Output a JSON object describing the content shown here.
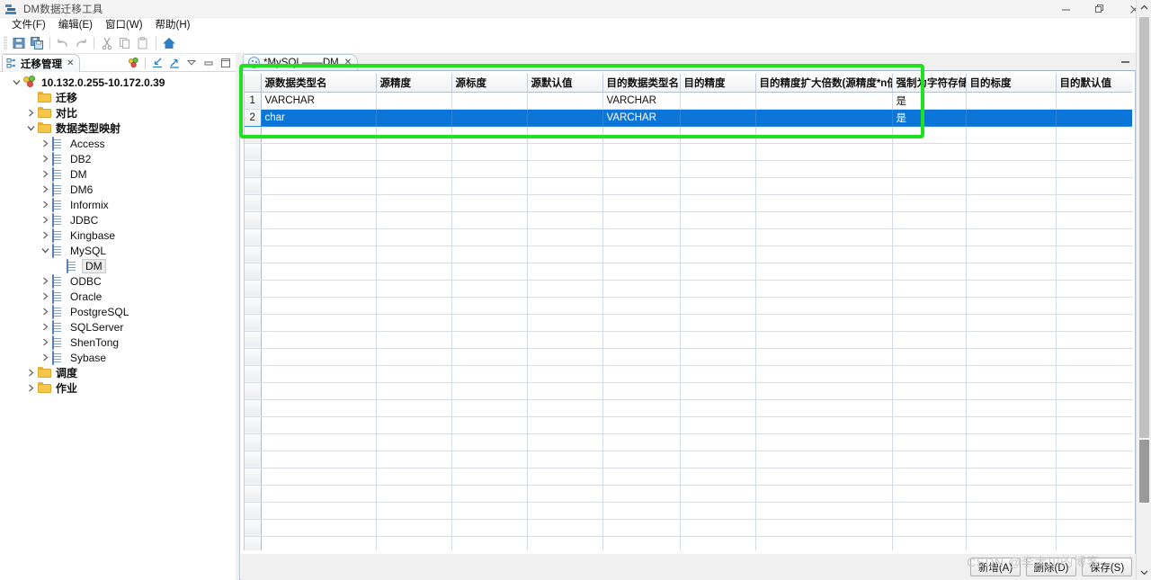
{
  "window": {
    "title": "DM数据迁移工具",
    "app_icon": "database-stack-icon",
    "controls": {
      "minimize": "minimize-icon",
      "restore": "restore-icon",
      "close": "close-icon"
    }
  },
  "menubar": {
    "items": [
      {
        "label": "文件(F)"
      },
      {
        "label": "编辑(E)"
      },
      {
        "label": "窗口(W)"
      },
      {
        "label": "帮助(H)"
      }
    ]
  },
  "toolbar": {
    "buttons": [
      {
        "name": "save-icon",
        "glyph": "floppy"
      },
      {
        "name": "save-all-icon",
        "glyph": "floppy-multi"
      },
      {
        "name": "undo-icon",
        "glyph": "undo"
      },
      {
        "name": "redo-icon",
        "glyph": "redo"
      },
      {
        "name": "cut-icon",
        "glyph": "scissors"
      },
      {
        "name": "copy-icon",
        "glyph": "copy"
      },
      {
        "name": "paste-icon",
        "glyph": "clipboard"
      },
      {
        "name": "home-icon",
        "glyph": "home"
      }
    ]
  },
  "sidebar": {
    "view_tab": {
      "label": "迁移管理",
      "icon": "migration-manage-icon",
      "close": "✕"
    },
    "view_tools": [
      {
        "name": "new-connection-icon"
      },
      {
        "name": "import-icon"
      },
      {
        "name": "export-icon"
      },
      {
        "name": "view-menu-icon"
      },
      {
        "name": "minimize-view-icon"
      },
      {
        "name": "maximize-view-icon"
      }
    ],
    "tree": [
      {
        "label": "10.132.0.255-10.172.0.39",
        "indent": 0,
        "twist": "expanded",
        "icon": "connection-icon",
        "bold": true,
        "selected": false
      },
      {
        "label": "迁移",
        "indent": 1,
        "twist": "none",
        "icon": "folder-icon",
        "bold": true,
        "selected": false
      },
      {
        "label": "对比",
        "indent": 1,
        "twist": "collapsed",
        "icon": "folder-icon",
        "bold": true,
        "selected": false
      },
      {
        "label": "数据类型映射",
        "indent": 1,
        "twist": "expanded",
        "icon": "folder-icon",
        "bold": true,
        "selected": false
      },
      {
        "label": "Access",
        "indent": 2,
        "twist": "collapsed",
        "icon": "db-icon",
        "bold": false,
        "selected": false
      },
      {
        "label": "DB2",
        "indent": 2,
        "twist": "collapsed",
        "icon": "db-icon",
        "bold": false,
        "selected": false
      },
      {
        "label": "DM",
        "indent": 2,
        "twist": "collapsed",
        "icon": "db-icon",
        "bold": false,
        "selected": false
      },
      {
        "label": "DM6",
        "indent": 2,
        "twist": "collapsed",
        "icon": "db-icon",
        "bold": false,
        "selected": false
      },
      {
        "label": "Informix",
        "indent": 2,
        "twist": "collapsed",
        "icon": "db-icon",
        "bold": false,
        "selected": false
      },
      {
        "label": "JDBC",
        "indent": 2,
        "twist": "collapsed",
        "icon": "db-icon",
        "bold": false,
        "selected": false
      },
      {
        "label": "Kingbase",
        "indent": 2,
        "twist": "collapsed",
        "icon": "db-icon",
        "bold": false,
        "selected": false
      },
      {
        "label": "MySQL",
        "indent": 2,
        "twist": "expanded",
        "icon": "db-icon",
        "bold": false,
        "selected": false
      },
      {
        "label": "DM",
        "indent": 3,
        "twist": "none",
        "icon": "db-icon",
        "bold": false,
        "selected": true
      },
      {
        "label": "ODBC",
        "indent": 2,
        "twist": "collapsed",
        "icon": "db-icon",
        "bold": false,
        "selected": false
      },
      {
        "label": "Oracle",
        "indent": 2,
        "twist": "collapsed",
        "icon": "db-icon",
        "bold": false,
        "selected": false
      },
      {
        "label": "PostgreSQL",
        "indent": 2,
        "twist": "collapsed",
        "icon": "db-icon",
        "bold": false,
        "selected": false
      },
      {
        "label": "SQLServer",
        "indent": 2,
        "twist": "collapsed",
        "icon": "db-icon",
        "bold": false,
        "selected": false
      },
      {
        "label": "ShenTong",
        "indent": 2,
        "twist": "collapsed",
        "icon": "db-icon",
        "bold": false,
        "selected": false
      },
      {
        "label": "Sybase",
        "indent": 2,
        "twist": "collapsed",
        "icon": "db-icon",
        "bold": false,
        "selected": false
      },
      {
        "label": "调度",
        "indent": 1,
        "twist": "collapsed",
        "icon": "folder-icon",
        "bold": true,
        "selected": false
      },
      {
        "label": "作业",
        "indent": 1,
        "twist": "collapsed",
        "icon": "folder-icon",
        "bold": true,
        "selected": false
      }
    ]
  },
  "editor": {
    "tab": {
      "label": "*MySQL——DM",
      "icon": "mapping-editor-icon",
      "close": "✕"
    },
    "minimize": "minimize-editor-icon",
    "grid": {
      "columns": [
        "源数据类型名",
        "源精度",
        "源标度",
        "源默认值",
        "目的数据类型名",
        "目的精度",
        "目的精度扩大倍数(源精度*n倍)",
        "强制为字符存储",
        "目的标度",
        "目的默认值"
      ],
      "rows": [
        {
          "num": "1",
          "selected": false,
          "cells": [
            "VARCHAR",
            "",
            "",
            "",
            "VARCHAR",
            "",
            "",
            "是",
            "",
            ""
          ]
        },
        {
          "num": "2",
          "selected": true,
          "cells": [
            "char",
            "",
            "",
            "",
            "VARCHAR",
            "",
            "",
            "是",
            "",
            ""
          ]
        }
      ],
      "empty_row_count": 25
    },
    "buttons": {
      "add": "新增(A)",
      "delete": "删除(D)",
      "save": "保存(S)"
    }
  },
  "annotation": {
    "highlight_color": "#20e020",
    "shape": "rectangle"
  },
  "watermark": {
    "text": "CSDN @李大川的博客"
  },
  "scrollbar": {
    "up_arrow": "chevron-up-icon",
    "down_arrow": "chevron-down-icon"
  }
}
